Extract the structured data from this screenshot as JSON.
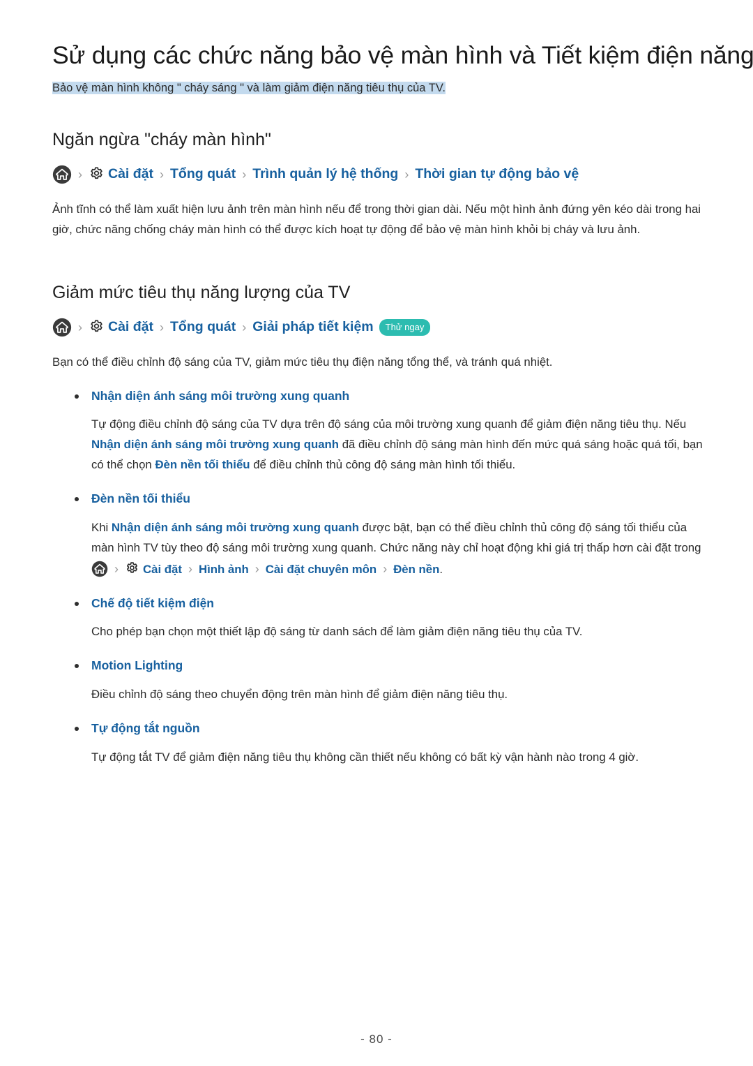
{
  "document": {
    "title": "Sử dụng các chức năng bảo vệ màn hình và Tiết kiệm điện năng",
    "subtitle": "Bảo vệ màn hình không \" cháy sáng \" và làm giảm điện năng tiêu thụ của TV.",
    "page_number": "- 80 -"
  },
  "colors": {
    "link_blue": "#17609f",
    "highlight": "#c3daee",
    "badge_teal": "#2cbcb0",
    "bullet": "#2e2e2e",
    "separator_gray": "#9a9a9a"
  },
  "icons": {
    "home": "home-icon",
    "gear": "gear-icon",
    "chevron": "›"
  },
  "sections": [
    {
      "heading": "Ngăn ngừa \"cháy màn hình\"",
      "breadcrumb": {
        "home_label": "home",
        "items": [
          "Cài đặt",
          "Tổng quát",
          "Trình quản lý hệ thống",
          "Thời gian tự động bảo vệ"
        ],
        "badge": null
      },
      "paragraph": "Ảnh tĩnh có thể làm xuất hiện lưu ảnh trên màn hình nếu để trong thời gian dài. Nếu một hình ảnh đứng yên kéo dài trong hai giờ, chức năng chống cháy màn hình có thể được kích hoạt tự động để bảo vệ màn hình khỏi bị cháy và lưu ảnh."
    },
    {
      "heading": "Giảm mức tiêu thụ năng lượng của TV",
      "breadcrumb": {
        "home_label": "home",
        "items": [
          "Cài đặt",
          "Tổng quát",
          "Giải pháp tiết kiệm"
        ],
        "badge": "Thử ngay"
      },
      "paragraph": "Bạn có thể điều chỉnh độ sáng của TV, giảm mức tiêu thụ điện năng tổng thể, và tránh quá nhiệt."
    }
  ],
  "bullets": [
    {
      "title": "Nhận diện ánh sáng môi trường xung quanh",
      "body_parts": [
        {
          "text": "Tự động điều chỉnh độ sáng của TV dựa trên độ sáng của môi trường xung quanh để giảm điện năng tiêu thụ. Nếu ",
          "link": false
        },
        {
          "text": "Nhận diện ánh sáng môi trường xung quanh",
          "link": true
        },
        {
          "text": " đã điều chỉnh độ sáng màn hình đến mức quá sáng hoặc quá tối, bạn có thể chọn ",
          "link": false
        },
        {
          "text": "Đèn nền tối thiểu",
          "link": true
        },
        {
          "text": " để điều chỉnh thủ công độ sáng màn hình tối thiểu.",
          "link": false
        }
      ]
    },
    {
      "title": "Đèn nền tối thiểu",
      "body_parts": [
        {
          "text": "Khi ",
          "link": false
        },
        {
          "text": "Nhận diện ánh sáng môi trường xung quanh",
          "link": true
        },
        {
          "text": " được bật, bạn có thể điều chỉnh thủ công độ sáng tối thiểu của màn hình TV tùy theo độ sáng môi trường xung quanh. Chức năng này chỉ hoạt động khi giá trị thấp hơn cài đặt trong ",
          "link": false
        }
      ],
      "inline_breadcrumb": {
        "home_label": "home",
        "items": [
          "Cài đặt",
          "Hình ảnh",
          "Cài đặt chuyên môn",
          "Đèn nền"
        ],
        "trailing": "."
      }
    },
    {
      "title": "Chế độ tiết kiệm điện",
      "body_parts": [
        {
          "text": "Cho phép bạn chọn một thiết lập độ sáng từ danh sách để làm giảm điện năng tiêu thụ của TV.",
          "link": false
        }
      ]
    },
    {
      "title": "Motion Lighting",
      "body_parts": [
        {
          "text": "Điều chỉnh độ sáng theo chuyển động trên màn hình để giảm điện năng tiêu thụ.",
          "link": false
        }
      ]
    },
    {
      "title": "Tự động tắt nguồn",
      "body_parts": [
        {
          "text": "Tự động tắt TV để giảm điện năng tiêu thụ không cần thiết nếu không có bất kỳ vận hành nào trong 4 giờ.",
          "link": false
        }
      ]
    }
  ]
}
